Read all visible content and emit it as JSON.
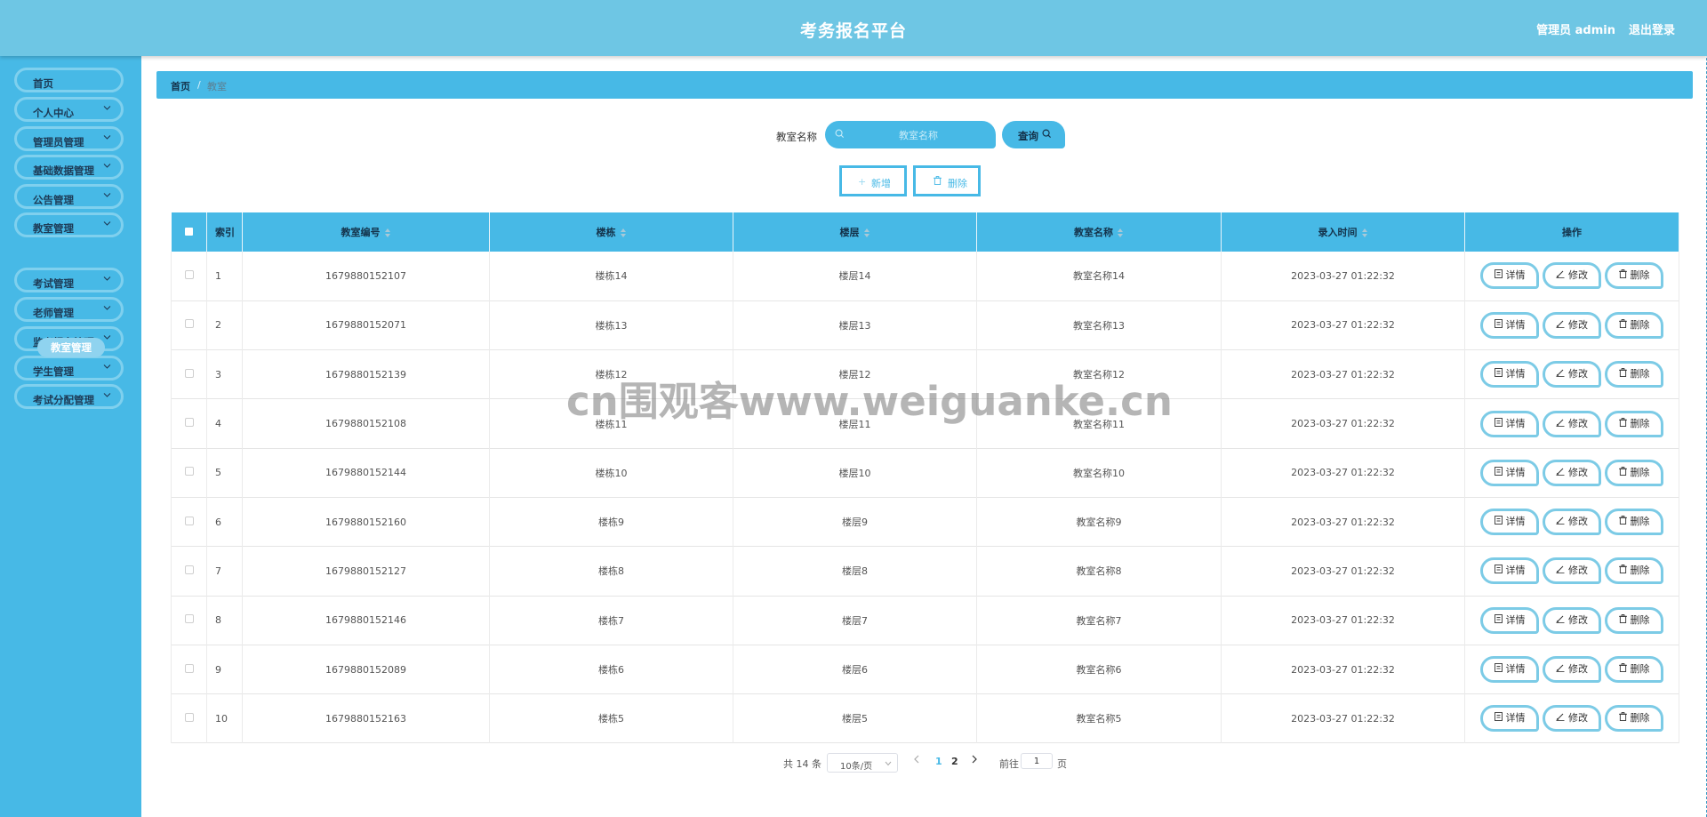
{
  "header": {
    "title": "考务报名平台",
    "user": "管理员 admin",
    "logout": "退出登录"
  },
  "sidebar": {
    "items": [
      {
        "label": "首页",
        "has_arrow": false
      },
      {
        "label": "个人中心",
        "has_arrow": true
      },
      {
        "label": "管理员管理",
        "has_arrow": true
      },
      {
        "label": "基础数据管理",
        "has_arrow": true
      },
      {
        "label": "公告管理",
        "has_arrow": true
      },
      {
        "label": "教室管理",
        "has_arrow": true
      },
      {
        "label": "考试管理",
        "has_arrow": true
      },
      {
        "label": "老师管理",
        "has_arrow": true
      },
      {
        "label": "监考报名管理",
        "has_arrow": true
      },
      {
        "label": "学生管理",
        "has_arrow": true
      },
      {
        "label": "考试分配管理",
        "has_arrow": true
      }
    ],
    "active_submenu": "教室管理"
  },
  "breadcrumb": {
    "home": "首页",
    "separator": "/",
    "current": "教室"
  },
  "search": {
    "label": "教室名称",
    "placeholder": "教室名称",
    "query_label": "查询"
  },
  "actions": {
    "add_label": "新增",
    "delete_label": "删除"
  },
  "table": {
    "headers": {
      "index": "索引",
      "number": "教室编号",
      "building": "楼栋",
      "floor": "楼层",
      "name": "教室名称",
      "time": "录入时间",
      "ops": "操作"
    },
    "row_actions": {
      "detail": "详情",
      "edit": "修改",
      "delete": "删除"
    },
    "rows": [
      {
        "index": "1",
        "number": "1679880152107",
        "building": "楼栋14",
        "floor": "楼层14",
        "name": "教室名称14",
        "time": "2023-03-27 01:22:32"
      },
      {
        "index": "2",
        "number": "1679880152071",
        "building": "楼栋13",
        "floor": "楼层13",
        "name": "教室名称13",
        "time": "2023-03-27 01:22:32"
      },
      {
        "index": "3",
        "number": "1679880152139",
        "building": "楼栋12",
        "floor": "楼层12",
        "name": "教室名称12",
        "time": "2023-03-27 01:22:32"
      },
      {
        "index": "4",
        "number": "1679880152108",
        "building": "楼栋11",
        "floor": "楼层11",
        "name": "教室名称11",
        "time": "2023-03-27 01:22:32"
      },
      {
        "index": "5",
        "number": "1679880152144",
        "building": "楼栋10",
        "floor": "楼层10",
        "name": "教室名称10",
        "time": "2023-03-27 01:22:32"
      },
      {
        "index": "6",
        "number": "1679880152160",
        "building": "楼栋9",
        "floor": "楼层9",
        "name": "教室名称9",
        "time": "2023-03-27 01:22:32"
      },
      {
        "index": "7",
        "number": "1679880152127",
        "building": "楼栋8",
        "floor": "楼层8",
        "name": "教室名称8",
        "time": "2023-03-27 01:22:32"
      },
      {
        "index": "8",
        "number": "1679880152146",
        "building": "楼栋7",
        "floor": "楼层7",
        "name": "教室名称7",
        "time": "2023-03-27 01:22:32"
      },
      {
        "index": "9",
        "number": "1679880152089",
        "building": "楼栋6",
        "floor": "楼层6",
        "name": "教室名称6",
        "time": "2023-03-27 01:22:32"
      },
      {
        "index": "10",
        "number": "1679880152163",
        "building": "楼栋5",
        "floor": "楼层5",
        "name": "教室名称5",
        "time": "2023-03-27 01:22:32"
      }
    ]
  },
  "pagination": {
    "total": "共 14 条",
    "page_size": "10条/页",
    "pages": [
      "1",
      "2"
    ],
    "current_page": "1",
    "goto_label": "前往",
    "goto_value": "1",
    "page_suffix": "页"
  },
  "watermark": "cn围观客www.weiguanke.cn",
  "colors": {
    "header_bg": "#6ec6e4",
    "sidebar_bg": "#47b9e6",
    "accent": "#47b9e6",
    "button_border": "#7ccbe6"
  }
}
